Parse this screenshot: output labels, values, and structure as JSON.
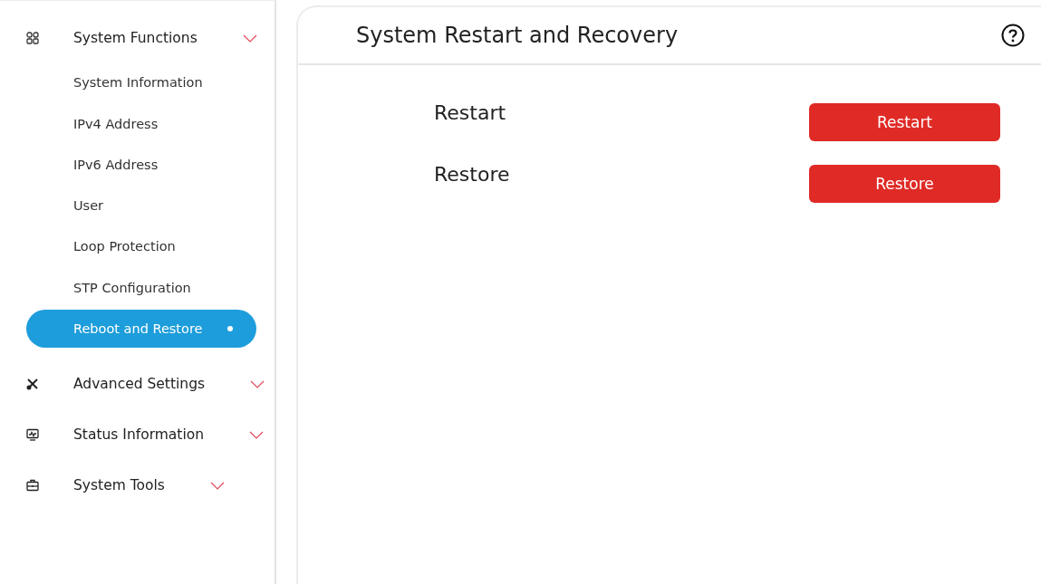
{
  "sidebar": {
    "groups": [
      {
        "label": "System Functions",
        "kind": "grid",
        "children": [
          {
            "label": "System Information",
            "selected": false
          },
          {
            "label": "IPv4 Address",
            "selected": false
          },
          {
            "label": "IPv6 Address",
            "selected": false
          },
          {
            "label": "User",
            "selected": false
          },
          {
            "label": "Loop Protection",
            "selected": false
          },
          {
            "label": "STP Configuration",
            "selected": false
          },
          {
            "label": "Reboot and Restore",
            "selected": true
          }
        ]
      },
      {
        "label": "Advanced Settings",
        "kind": "tools"
      },
      {
        "label": "Status Information",
        "kind": "monitor"
      },
      {
        "label": "System Tools",
        "kind": "toolbox"
      }
    ]
  },
  "panel": {
    "title": "System Restart and Recovery",
    "rows": [
      {
        "label": "Restart",
        "button": "Restart"
      },
      {
        "label": "Restore",
        "button": "Restore"
      }
    ]
  }
}
